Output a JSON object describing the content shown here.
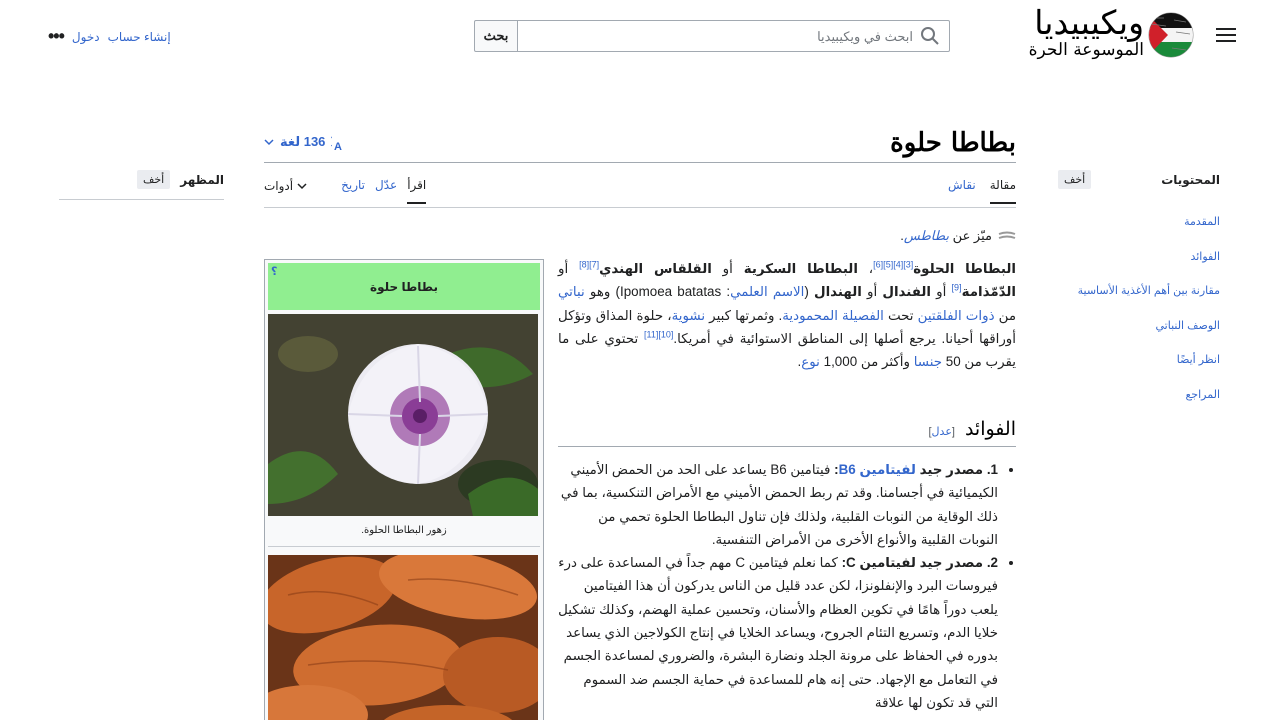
{
  "header": {
    "wordmark_line1": "ويكيبيديا",
    "wordmark_line2": "الموسوعة الحرة",
    "search_placeholder": "ابحث في ويكيبيديا",
    "search_button": "بحث",
    "create_account": "إنشاء حساب",
    "login": "دخول",
    "more": "•••"
  },
  "page": {
    "title": "بطاطا حلوة",
    "languages": "136 لغة"
  },
  "tabs": {
    "article": "مقالة",
    "talk": "نقاش",
    "read": "اقرأ",
    "edit": "عدّل",
    "history": "تاريخ",
    "tools": "أدوات"
  },
  "toc": {
    "title": "المحتويات",
    "hide": "أخف",
    "items": [
      "المقدمة",
      "الفوائد",
      "مقارنة بين أهم الأغذية الأساسية",
      "الوصف النباتي",
      "انظر أيضًا",
      "المراجع"
    ]
  },
  "appearance": {
    "title": "المظهر",
    "hide": "أخف"
  },
  "hatnote": {
    "prefix": "ميّز عن",
    "link": "بطاطس",
    "suffix": "."
  },
  "intro": {
    "b1": "البطاطا الحلوة",
    "r1": "[3][4][5][6]",
    "t1": "، ",
    "b2": "البطاطا السكرية",
    "t2": " أو ",
    "b3": "القلقاس الهندي",
    "r2": "[7][8]",
    "t3": " أو ",
    "b4": "الدّمّذامة",
    "r3": "[9]",
    "t4": " أو ",
    "b5": "الفندال",
    "t5": " أو ",
    "b6": "الهندال",
    "t6": " (",
    "l1": "الاسم العلمي",
    "t7": ": Ipomoea batatas) وهو ",
    "l2": "نباتي",
    "t8": " من ",
    "l3": "ذوات الفلقتين",
    "t9": " تحت ",
    "l4": "الفصيلة المحمودية",
    "t10": ". وثمرتها كبير ",
    "l5": "نشوية",
    "t11": "، حلوة المذاق وتؤكل أوراقها أحيانا. يرجع أصلها إلى المناطق الاستوائية في أمريكا.",
    "r4": "[10][11]",
    "t12": " تحتوي على ما يقرب من 50 ",
    "l6": "جنسا",
    "t13": " وأكثر من 1,000 ",
    "l7": "نوع",
    "t14": "."
  },
  "benefits": {
    "heading": "الفوائد",
    "edit_link": "عدل",
    "item1_bold": "1. مصدر جيد ",
    "item1_link": "لفيتامين B6",
    "item1_colon": ":",
    "item1_text": " فيتامين B6 يساعد على الحد من الحمض الأميني الكيميائية في أجسامنا. وقد تم ربط الحمض الأميني مع الأمراض التنكسية، بما في ذلك الوقاية من النوبات القلبية، ولذلك فإن تناول البطاطا الحلوة تحمي من النوبات القلبية والأنواع الأخرى من الأمراض التنفسية.",
    "item2_bold": "2. مصدر جيد لفيتامين C:",
    "item2_text": " كما نعلم فيتامين C مهم جداً في المساعدة على درء فيروسات البرد والإنفلونزا، لكن عدد قليل من الناس يدركون أن هذا الفيتامين يلعب دوراً هامًا في تكوين العظام والأسنان، وتحسين عملية الهضم، وكذلك تشكيل خلايا الدم، وتسريع التئام الجروح، ويساعد الخلايا في إنتاج الكولاجين الذي يساعد بدوره في الحفاظ على مرونة الجلد ونضارة البشرة، والضروري لمساعدة الجسم في التعامل مع الإجهاد. حتى إنه هام للمساعدة في حماية الجسم ضد السموم التي قد تكون لها علاقة"
  },
  "infobox": {
    "title": "بطاطا حلوة",
    "help": "؟",
    "caption1": "زهور البطاطا الحلوة."
  },
  "colors": {
    "link": "#3366cc",
    "infobox_header": "#90ee90"
  }
}
